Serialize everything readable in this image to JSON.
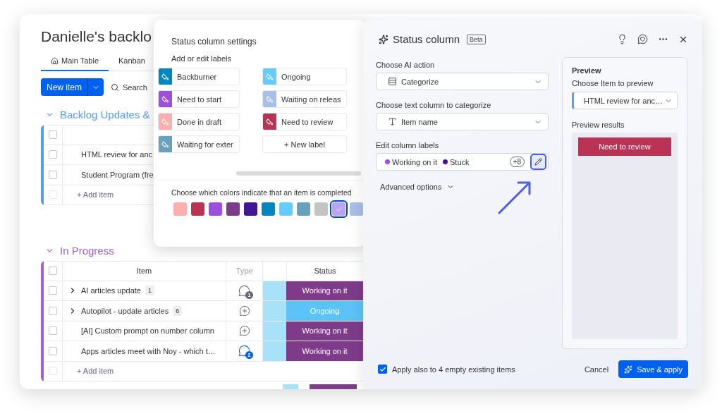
{
  "board": {
    "title": "Danielle's backlo",
    "tabs": [
      {
        "label": "Main Table",
        "selected": true
      },
      {
        "label": "Kanban",
        "selected": false
      }
    ],
    "toolbar": {
      "new_item": "New item",
      "search": "Search"
    },
    "groups": [
      {
        "title": "Backlog Updates &",
        "color": "#579bfc",
        "all_checked": false,
        "rows": [
          {
            "item": "HTML review for anc",
            "checked": false
          },
          {
            "item": "Student Program (fre",
            "checked": false
          }
        ],
        "add_item": "+ Add item",
        "add_row_checked": false
      },
      {
        "title": "In Progress",
        "color": "#a25ddc",
        "all_checked": false,
        "add_row_checked": false,
        "columns": [
          {
            "kind": "item",
            "label": "Item",
            "faded": false
          },
          {
            "kind": "type",
            "label": "Type",
            "faded": true
          },
          {
            "kind": "status",
            "label": "Status",
            "faded": false
          }
        ],
        "rows": [
          {
            "item": "AI articles update",
            "checked": false,
            "expandable": true,
            "subitems": "1",
            "updates": {
              "kind": "count",
              "count": "1",
              "unread": false
            },
            "status": {
              "label": "Working on it",
              "color": "#7e3b8a"
            }
          },
          {
            "item": "Autopilot - update articles",
            "checked": false,
            "expandable": true,
            "subitems": "6",
            "updates": {
              "kind": "add"
            },
            "status": {
              "label": "Ongoing",
              "color": "#5cc3f7"
            }
          },
          {
            "item": "[AI] Custom prompt on number column",
            "checked": false,
            "expandable": false,
            "updates": {
              "kind": "add"
            },
            "status": {
              "label": "Working on it",
              "color": "#7e3b8a"
            }
          },
          {
            "item": "Apps articles meet with Noy - which t…",
            "checked": false,
            "expandable": false,
            "updates": {
              "kind": "count",
              "count": "2",
              "unread": true
            },
            "status": {
              "label": "Working on it",
              "color": "#7e3b8a"
            }
          }
        ],
        "add_item": "+ Add item"
      }
    ]
  },
  "popover": {
    "title": "Status column settings",
    "subtitle": "Add or edit labels",
    "labels": [
      {
        "label": "Backburner",
        "color": "#0086c0"
      },
      {
        "label": "Ongoing",
        "color": "#66ccff"
      },
      {
        "label": "Need to start",
        "color": "#9d50dd"
      },
      {
        "label": "Waiting on releas",
        "color": "#a9bee8"
      },
      {
        "label": "Done in draft",
        "color": "#ffadad"
      },
      {
        "label": "Need to review",
        "color": "#bb3354"
      },
      {
        "label": "Waiting for exter",
        "color": "#68a1bd"
      }
    ],
    "new_label": "+ New label",
    "completion_prompt": "Choose which colors indicate that an item is completed",
    "swatches": [
      {
        "color": "#ffadad",
        "selected": false
      },
      {
        "color": "#bb3354",
        "selected": false
      },
      {
        "color": "#9d50dd",
        "selected": false
      },
      {
        "color": "#7e3b8a",
        "selected": false
      },
      {
        "color": "#401694",
        "selected": false
      },
      {
        "color": "#0086c0",
        "selected": false
      },
      {
        "color": "#66ccff",
        "selected": false
      },
      {
        "color": "#68a1bd",
        "selected": false
      },
      {
        "color": "#c4c4c4",
        "selected": false
      },
      {
        "color": "#b9a3f5",
        "selected": true
      },
      {
        "color": "#a9bee8",
        "selected": false
      }
    ]
  },
  "panel": {
    "title": "Status column",
    "badge": "Beta",
    "fields": [
      {
        "label": "Choose AI action",
        "value": "Categorize"
      },
      {
        "label": "Choose text column to categorize",
        "value": "Item name"
      }
    ],
    "labels_field": {
      "label": "Edit column labels",
      "chips": [
        {
          "label": "Working on it",
          "color": "#9d50dd"
        },
        {
          "label": "Stuck",
          "color": "#401694"
        }
      ],
      "more": "+8"
    },
    "advanced": "Advanced options",
    "preview": {
      "title": "Preview",
      "select_label": "Choose Item to preview",
      "select_value": "HTML review for anc…",
      "results_label": "Preview results",
      "result": {
        "label": "Need to review",
        "color": "#bb3354"
      }
    },
    "apply": {
      "label": "Apply also to 4 empty existing items",
      "checked": true
    },
    "cancel": "Cancel",
    "save": "Save & apply"
  }
}
